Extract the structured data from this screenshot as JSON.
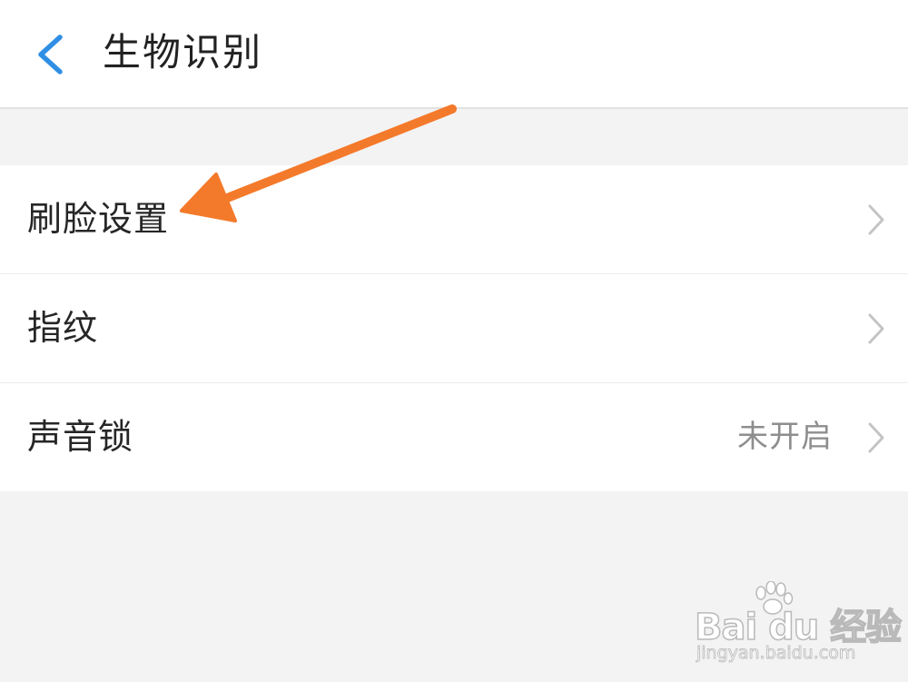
{
  "header": {
    "title": "生物识别",
    "back_icon": "chevron-left-icon",
    "accent": "#2f8fe4"
  },
  "settings": {
    "items": [
      {
        "label": "刷脸设置",
        "value": "",
        "icon": "chevron-right-icon"
      },
      {
        "label": "指纹",
        "value": "",
        "icon": "chevron-right-icon"
      },
      {
        "label": "声音锁",
        "value": "未开启",
        "icon": "chevron-right-icon"
      }
    ]
  },
  "annotation": {
    "color": "#f47a2b",
    "icon": "arrow-pointer-icon"
  },
  "watermark": {
    "logo": "Bai du 经验",
    "url": "jingyan.baidu.com"
  }
}
